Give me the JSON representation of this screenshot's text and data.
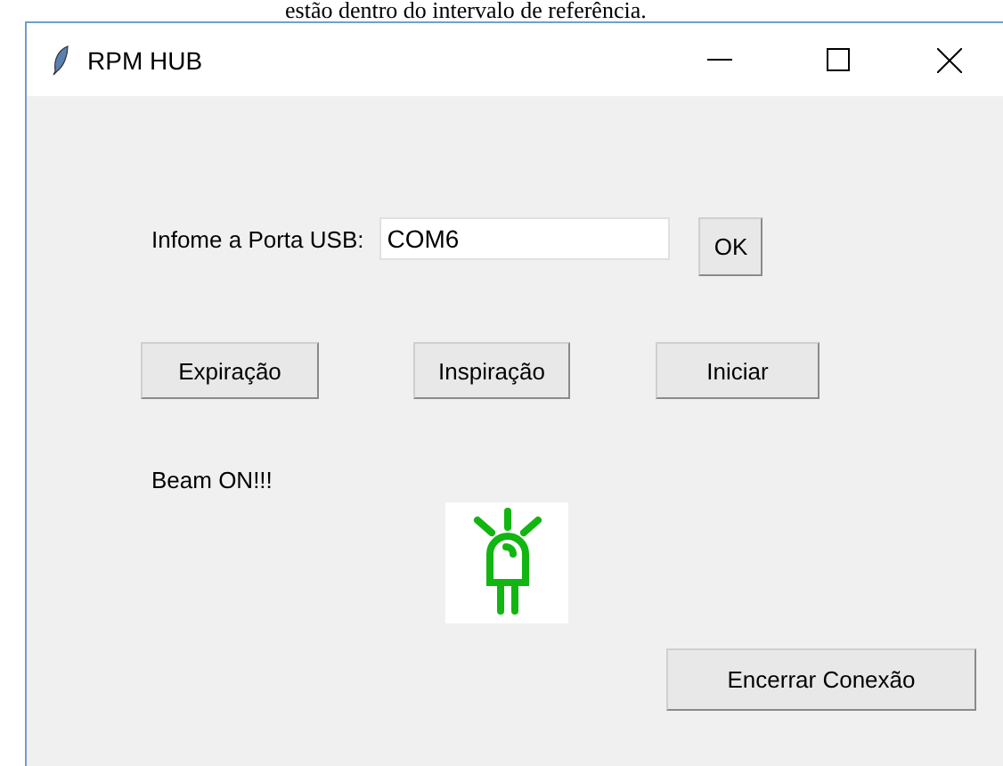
{
  "caption": "estão dentro do intervalo de referência.",
  "window": {
    "title": "RPM HUB"
  },
  "port": {
    "label": "Infome a Porta USB:",
    "value": "COM6",
    "button": "OK"
  },
  "buttons": [
    "Expiração",
    "Inspiração",
    "Iniciar"
  ],
  "status": "Beam ON!!!",
  "led": {
    "on": true
  },
  "close_button": "Encerrar Conexão"
}
